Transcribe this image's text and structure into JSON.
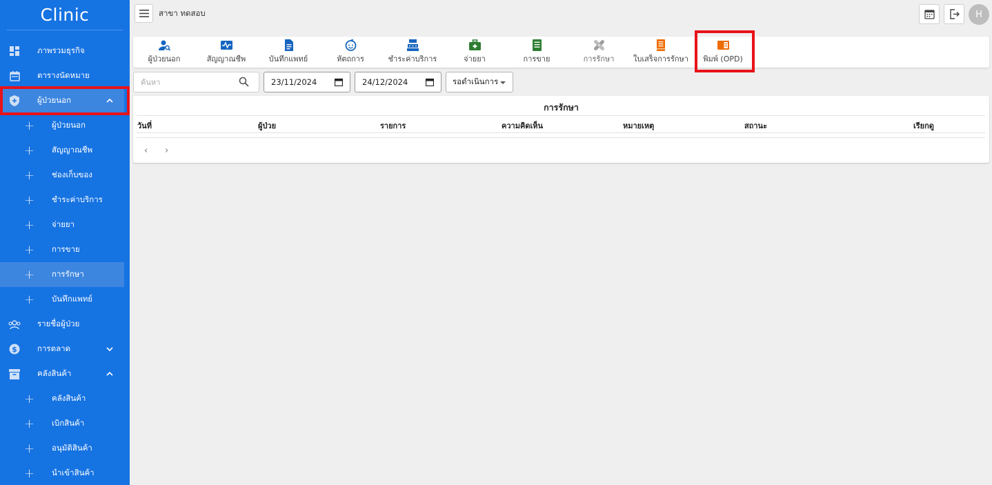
{
  "sidebar": {
    "brand": "Clinic",
    "items": [
      {
        "label": "ภาพรวมธุรกิจ",
        "icon": "dashboard-icon"
      },
      {
        "label": "ตารางนัดหมาย",
        "icon": "calendar-icon"
      },
      {
        "label": "ผู้ป่วยนอก",
        "icon": "shield-icon",
        "expanded": true
      },
      {
        "label": "รายชื่อผู้ป่วย",
        "icon": "people-icon"
      },
      {
        "label": "การตลาด",
        "icon": "dollar-icon",
        "expanded": false
      },
      {
        "label": "คลังสินค้า",
        "icon": "archive-icon",
        "expanded": true
      }
    ],
    "outpatient_sub": [
      "ผู้ป่วยนอก",
      "สัญญาณชีพ",
      "ช่องเก็บของ",
      "ชำระค่าบริการ",
      "จ่ายยา",
      "การขาย",
      "การรักษา",
      "บันทึกแพทย์"
    ],
    "inventory_sub": [
      "คลังสินค้า",
      "เบิกสินค้า",
      "อนุมัติสินค้า",
      "นำเข้าสินค้า"
    ],
    "active_sub": "การรักษา"
  },
  "topbar": {
    "branch": "สาขา ทดสอบ",
    "avatar_initial": "H"
  },
  "toolbar": {
    "tools": [
      {
        "label": "ผู้ป่วยนอก",
        "icon": "user-search-icon",
        "color": "#1565c0"
      },
      {
        "label": "สัญญาณชีพ",
        "icon": "heartbeat-icon",
        "color": "#1565c0"
      },
      {
        "label": "บันทึกแพทย์",
        "icon": "document-icon",
        "color": "#1565c0"
      },
      {
        "label": "หัตถการ",
        "icon": "baby-face-icon",
        "color": "#1565c0"
      },
      {
        "label": "ชำระค่าบริการ",
        "icon": "cash-register-icon",
        "color": "#1565c0"
      },
      {
        "label": "จ่ายยา",
        "icon": "medical-kit-icon",
        "color": "#2e7d32"
      },
      {
        "label": "การขาย",
        "icon": "receipt-icon",
        "color": "#2e7d32"
      },
      {
        "label": "การรักษา",
        "icon": "bandage-icon",
        "color": "#9e9e9e"
      },
      {
        "label": "ใบเสร็จการรักษา",
        "icon": "bill-icon",
        "color": "#ef6c00"
      },
      {
        "label": "พิมพ์ (OPD)",
        "icon": "book-icon",
        "color": "#ef6c00"
      }
    ]
  },
  "filters": {
    "search_placeholder": "ค้นหา",
    "date_from": "23/11/2024",
    "date_to": "24/12/2024",
    "status_selected": "รอดำเนินการ"
  },
  "table": {
    "title": "การรักษา",
    "columns": [
      "วันที่",
      "ผู้ป่วย",
      "รายการ",
      "ความคิดเห็น",
      "หมายเหตุ",
      "สถานะ",
      "เรียกดู"
    ],
    "prev": "‹",
    "next": "›"
  },
  "colors": {
    "sidebar": "#1673e2",
    "highlight": "#e8131a"
  }
}
